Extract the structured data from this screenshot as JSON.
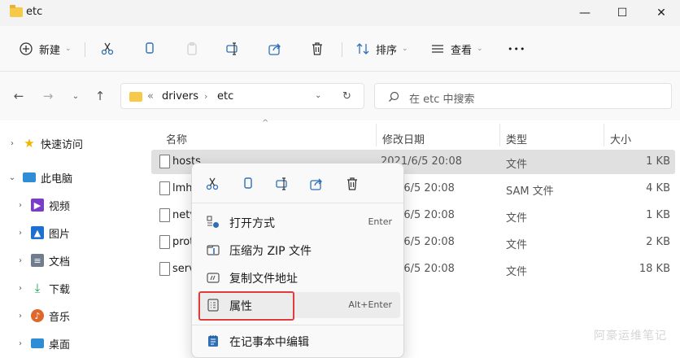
{
  "window": {
    "title": "etc"
  },
  "toolbar": {
    "new_label": "新建",
    "sort_label": "排序",
    "view_label": "查看",
    "more_label": "•••"
  },
  "address": {
    "collapse": "«",
    "crumbs": [
      "drivers",
      "etc"
    ]
  },
  "search": {
    "placeholder": "在 etc 中搜索"
  },
  "sidebar": {
    "items": [
      {
        "label": "快速访问",
        "expanded": false
      },
      {
        "label": "此电脑",
        "expanded": true
      },
      {
        "label": "视频"
      },
      {
        "label": "图片"
      },
      {
        "label": "文档"
      },
      {
        "label": "下载"
      },
      {
        "label": "音乐"
      },
      {
        "label": "桌面"
      }
    ]
  },
  "columns": {
    "name": "名称",
    "modified": "修改日期",
    "type": "类型",
    "size": "大小"
  },
  "files": [
    {
      "name": "hosts",
      "modified": "2021/6/5 20:08",
      "type": "文件",
      "size": "1 KB"
    },
    {
      "name": "lmh",
      "modified": "/6/5 20:08",
      "type": "SAM 文件",
      "size": "4 KB"
    },
    {
      "name": "netv",
      "modified": "/6/5 20:08",
      "type": "文件",
      "size": "1 KB"
    },
    {
      "name": "prot",
      "modified": "/6/5 20:08",
      "type": "文件",
      "size": "2 KB"
    },
    {
      "name": "serv",
      "modified": "/6/5 20:08",
      "type": "文件",
      "size": "18 KB"
    }
  ],
  "context_menu": {
    "items": [
      {
        "label": "打开方式",
        "shortcut": "Enter"
      },
      {
        "label": "压缩为 ZIP 文件",
        "shortcut": ""
      },
      {
        "label": "复制文件地址",
        "shortcut": ""
      },
      {
        "label": "属性",
        "shortcut": "Alt+Enter"
      },
      {
        "label": "在记事本中编辑",
        "shortcut": ""
      }
    ]
  },
  "watermark": "阿豪运维笔记"
}
